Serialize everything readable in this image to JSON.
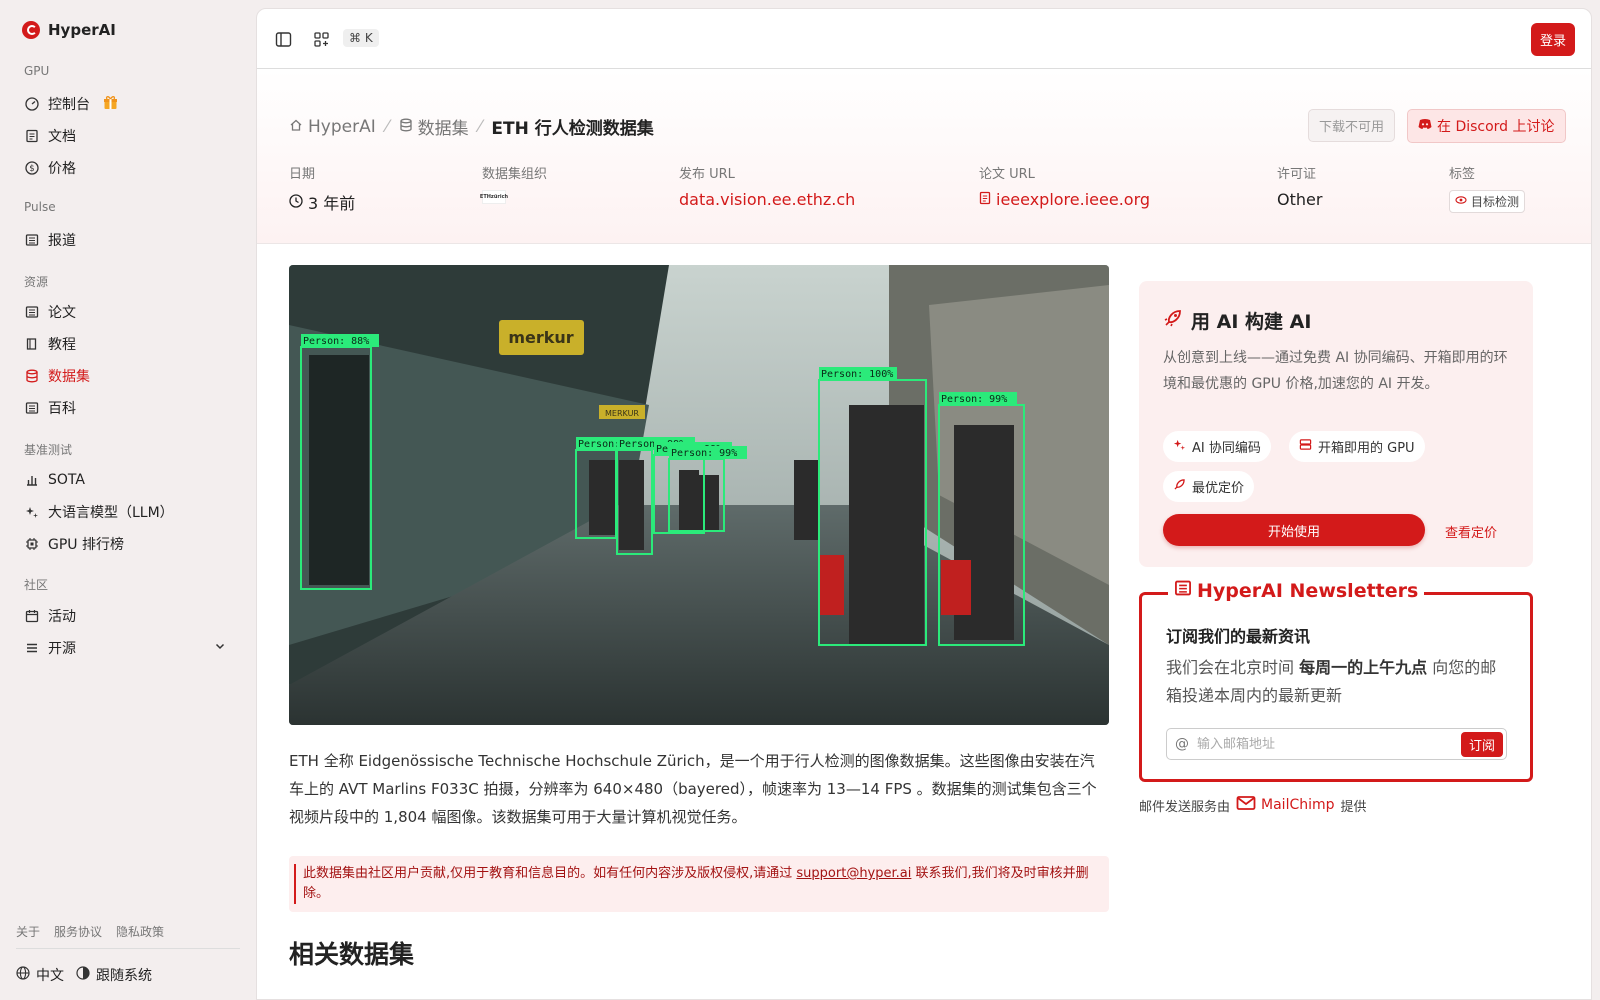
{
  "app": {
    "name": "HyperAI"
  },
  "sidebar": {
    "sections": [
      {
        "label": "GPU",
        "items": [
          {
            "label": "控制台",
            "icon": "gauge-icon",
            "badge": "gift-icon"
          },
          {
            "label": "文档",
            "icon": "doc-icon"
          },
          {
            "label": "价格",
            "icon": "dollar-icon"
          }
        ]
      },
      {
        "label": "Pulse",
        "items": [
          {
            "label": "报道",
            "icon": "newspaper-icon"
          }
        ]
      },
      {
        "label": "资源",
        "items": [
          {
            "label": "论文",
            "icon": "newspaper-icon"
          },
          {
            "label": "教程",
            "icon": "book-icon"
          },
          {
            "label": "数据集",
            "icon": "database-icon",
            "active": true
          },
          {
            "label": "百科",
            "icon": "newspaper-icon"
          }
        ]
      },
      {
        "label": "基准测试",
        "items": [
          {
            "label": "SOTA",
            "icon": "bar-chart-icon"
          },
          {
            "label": "大语言模型（LLM）",
            "icon": "sparkles-icon"
          },
          {
            "label": "GPU 排行榜",
            "icon": "cpu-icon"
          }
        ]
      },
      {
        "label": "社区",
        "items": [
          {
            "label": "活动",
            "icon": "calendar-icon"
          },
          {
            "label": "开源",
            "icon": "list-icon",
            "expandable": true
          }
        ]
      }
    ],
    "footer_links": [
      "关于",
      "服务协议",
      "隐私政策"
    ],
    "language": "中文",
    "theme": "跟随系统"
  },
  "topbar": {
    "shortcut": "⌘ K",
    "login": "登录"
  },
  "breadcrumb": {
    "home": "HyperAI",
    "section": "数据集",
    "current": "ETH 行人检测数据集"
  },
  "actions": {
    "download": "下载不可用",
    "discord": "在 Discord 上讨论"
  },
  "meta": {
    "date_label": "日期",
    "date_value": "3 年前",
    "org_label": "数据集组织",
    "org_logo_text": "ETHzürich",
    "release_label": "发布 URL",
    "release_value": "data.vision.ee.ethz.ch",
    "paper_label": "论文 URL",
    "paper_value": "ieeexplore.ieee.org",
    "license_label": "许可证",
    "license_value": "Other",
    "tags_label": "标签",
    "tag": "目标检测"
  },
  "hero": {
    "detections": [
      {
        "label": "Person: 88%"
      },
      {
        "label": "Person: 99%"
      },
      {
        "label": "Person: 99%"
      },
      {
        "label": "Person: 99%"
      },
      {
        "label": "Person: 99%"
      },
      {
        "label": "Person: 100%"
      },
      {
        "label": "Person: 99%"
      }
    ],
    "shop_sign": "merkur",
    "shop_sign_2": "MERKUR"
  },
  "description": "ETH 全称 Eidgenössische Technische Hochschule Zürich，是一个用于行人检测的图像数据集。这些图像由安装在汽车上的 AVT Marlins F033C 拍摄，分辨率为 640×480（bayered），帧速率为 13—14 FPS 。数据集的测试集包含三个视频片段中的 1,804 幅图像。该数据集可用于大量计算机视觉任务。",
  "notice": {
    "before": "此数据集由社区用户贡献,仅用于教育和信息目的。如有任何内容涉及版权侵权,请通过 ",
    "email": "support@hyper.ai",
    "after": " 联系我们,我们将及时审核并删除。"
  },
  "related_title": "相关数据集",
  "cta": {
    "title": "用 AI 构建 AI",
    "desc": "从创意到上线——通过免费 AI 协同编码、开箱即用的环境和最优惠的 GPU 价格,加速您的 AI 开发。",
    "pill1": "AI 协同编码",
    "pill2": "开箱即用的 GPU",
    "pill3": "最优定价",
    "start": "开始使用",
    "pricing": "查看定价"
  },
  "newsletter": {
    "title": "HyperAI Newsletters",
    "heading": "订阅我们的最新资讯",
    "text_before": "我们会在北京时间 ",
    "text_bold": "每周一的上午九点",
    "text_after": " 向您的邮箱投递本周内的最新更新",
    "placeholder": "输入邮箱地址",
    "subscribe": "订阅"
  },
  "mail_service": {
    "before": "邮件发送服务由",
    "name": "MailChimp",
    "after": "提供"
  },
  "colors": {
    "accent": "#d31a1a",
    "box": "#2bea7a"
  }
}
